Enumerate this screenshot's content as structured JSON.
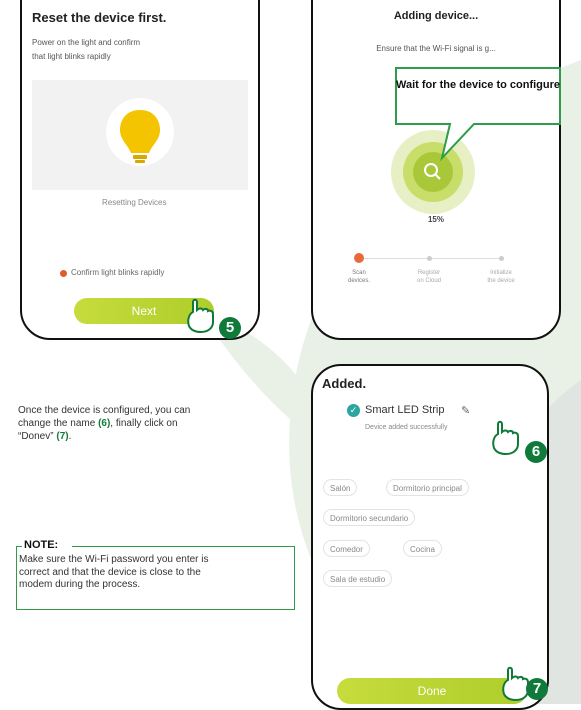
{
  "screen1": {
    "title": "Reset the device first.",
    "instruction_line1": "Power on the light and confirm",
    "instruction_line2": "that light blinks rapidly",
    "status": "Resetting Devices",
    "confirm_label": "Confirm light blinks rapidly",
    "next_button": "Next",
    "step": "5"
  },
  "screen2": {
    "title": "Adding device...",
    "subtitle": "Ensure that the Wi-Fi signal is g...",
    "callout": "Wait for the device to configure",
    "progress_label": "15%",
    "progress_fraction": 0.15,
    "steps": [
      {
        "label_line1": "Scan",
        "label_line2": "devices."
      },
      {
        "label_line1": "Register",
        "label_line2": "on Cloud"
      },
      {
        "label_line1": "Initialize",
        "label_line2": "the device"
      }
    ]
  },
  "screen3": {
    "title": "Added.",
    "device_name": "Smart LED Strip",
    "device_status": "Device added successfully",
    "rooms": [
      "Salón",
      "Dormitorio principal",
      "Dormitorio secundario",
      "Comedor",
      "Cocina",
      "Sala de estudio"
    ],
    "done_button": "Done",
    "step_rename": "6",
    "step_done": "7"
  },
  "body_text": {
    "line1": "Once the device is configured, you can",
    "line2_pre": "change the name ",
    "line2_ref": "(6)",
    "line2_post": ", finally click on",
    "line3_pre": "“Donev” ",
    "line3_ref": "(7)",
    "line3_post": "."
  },
  "note": {
    "title": "NOTE:",
    "line1": "Make sure the Wi-Fi password you enter is",
    "line2": "correct and that the device is close to the",
    "line3": "modem during the process."
  },
  "colors": {
    "accent": "#0f7a3a",
    "lime": "#b8d432",
    "callout_border": "#2e9c48"
  }
}
